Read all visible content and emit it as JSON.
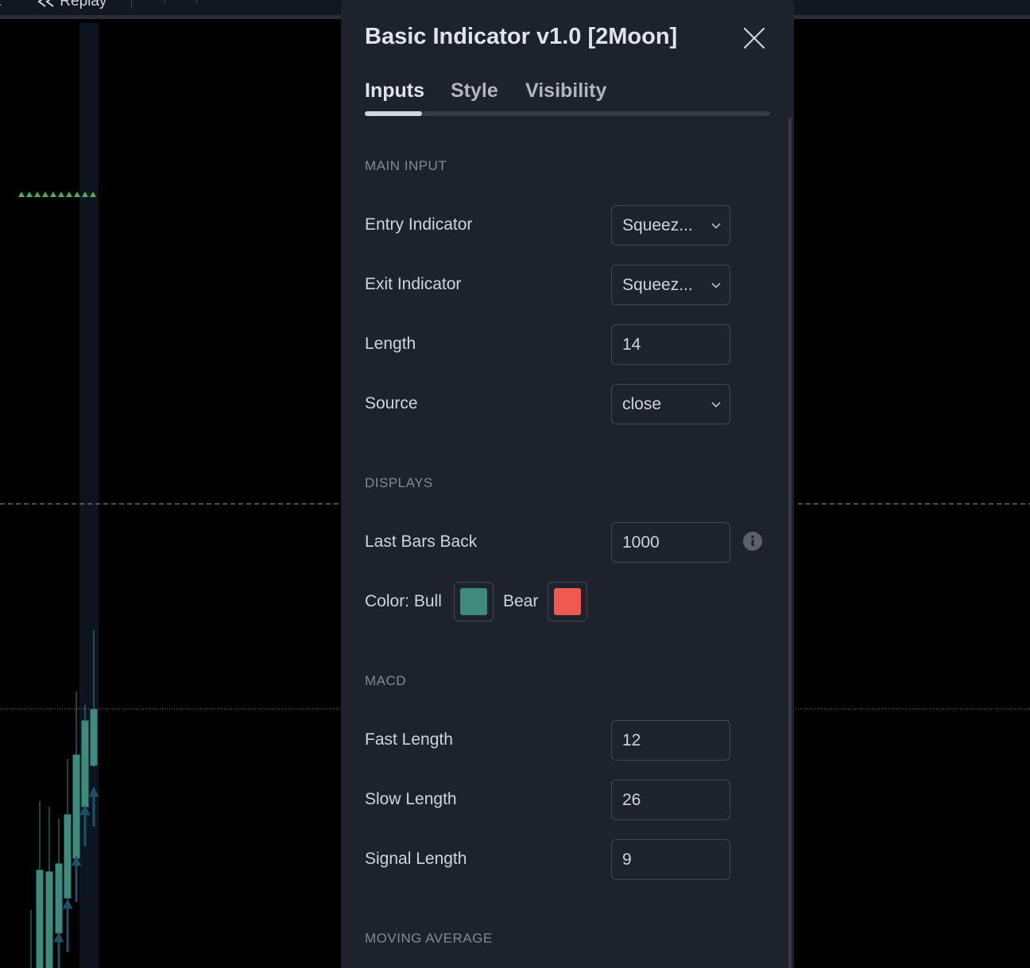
{
  "toolbar": {
    "replay_label": "Replay"
  },
  "dialog": {
    "title": "Basic Indicator v1.0 [2Moon]",
    "tabs": [
      {
        "label": "Inputs",
        "active": true
      },
      {
        "label": "Style",
        "active": false
      },
      {
        "label": "Visibility",
        "active": false
      }
    ]
  },
  "sections": {
    "main_input": "MAIN INPUT",
    "displays": "DISPLAYS",
    "macd": "MACD",
    "moving_average": "MOVING AVERAGE"
  },
  "main_input": {
    "entry_indicator": {
      "label": "Entry Indicator",
      "value": "Squeez..."
    },
    "exit_indicator": {
      "label": "Exit Indicator",
      "value": "Squeez..."
    },
    "length": {
      "label": "Length",
      "value": "14"
    },
    "source": {
      "label": "Source",
      "value": "close"
    }
  },
  "displays": {
    "last_bars_back": {
      "label": "Last Bars Back",
      "value": "1000"
    },
    "color_bull_label": "Color: Bull",
    "color_bear_label": "Bear",
    "bull_color": "#3e8a7d",
    "bear_color": "#ee5a52"
  },
  "macd": {
    "fast_length": {
      "label": "Fast Length",
      "value": "12"
    },
    "slow_length": {
      "label": "Slow Length",
      "value": "26"
    },
    "signal_length": {
      "label": "Signal Length",
      "value": "9"
    }
  },
  "icons": {
    "close": "close-icon",
    "chevron": "chevron-down-icon",
    "info": "info-icon",
    "replay": "rewind-icon"
  }
}
